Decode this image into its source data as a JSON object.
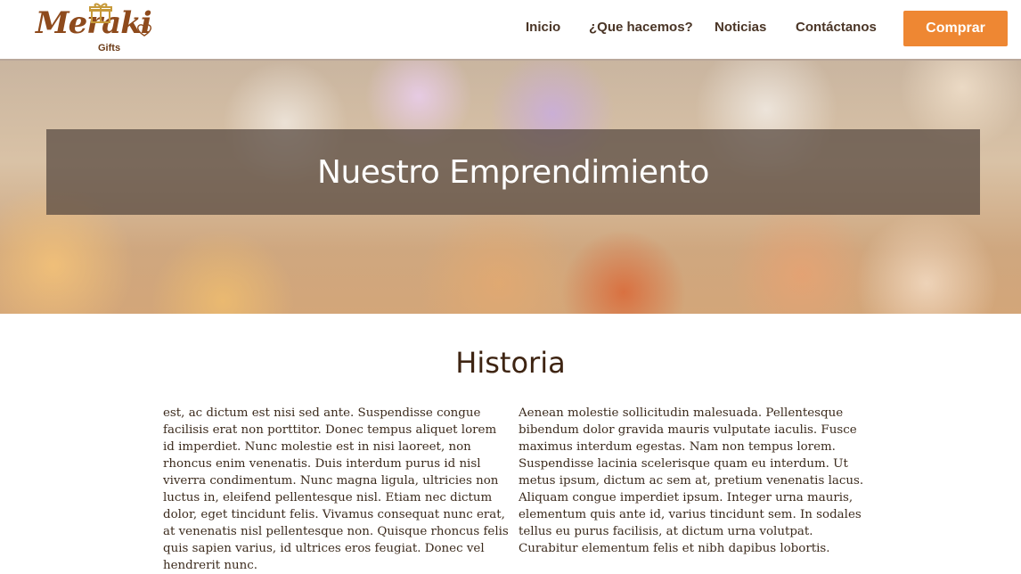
{
  "brand": {
    "name": "Meraki",
    "tagline": "Gifts"
  },
  "nav": {
    "items": [
      {
        "label": "Inicio"
      },
      {
        "label": "¿Que hacemos?"
      },
      {
        "label": "Noticias"
      },
      {
        "label": "Contáctanos"
      }
    ],
    "cta_label": "Comprar"
  },
  "hero": {
    "title": "Nuestro Emprendimiento"
  },
  "section": {
    "title": "Historia",
    "paragraph_left": "est, ac dictum est nisi sed ante. Suspendisse congue facilisis erat non porttitor. Donec tempus aliquet lorem id imperdiet. Nunc molestie est in nisi laoreet, non rhoncus enim venenatis. Duis interdum purus id nisl viverra condimentum. Nunc magna ligula, ultricies non luctus in, eleifend pellentesque nisl. Etiam nec dictum dolor, eget tincidunt felis. Vivamus consequat nunc erat, at venenatis nisl pellentesque non. Quisque rhoncus felis quis sapien varius, id ultrices eros feugiat. Donec vel hendrerit nunc.",
    "paragraph_right": "Aenean molestie sollicitudin malesuada. Pellentesque bibendum dolor gravida mauris vulputate iaculis. Fusce maximus interdum egestas. Nam non tempus lorem. Suspendisse lacinia scelerisque quam eu interdum. Ut metus ipsum, dictum ac sem at, pretium venenatis lacus. Aliquam congue imperdiet ipsum. Integer urna mauris, elementum quis ante id, varius tincidunt sem. In sodales tellus eu purus facilisis, at dictum urna volutpat. Curabitur elementum felis et nibh dapibus lobortis."
  },
  "colors": {
    "accent": "#ee8733",
    "brand": "#8e4a1c",
    "text": "#3b2a1c",
    "heading": "#3e2412"
  },
  "icons": [
    "gift-icon",
    "heart-icon"
  ]
}
